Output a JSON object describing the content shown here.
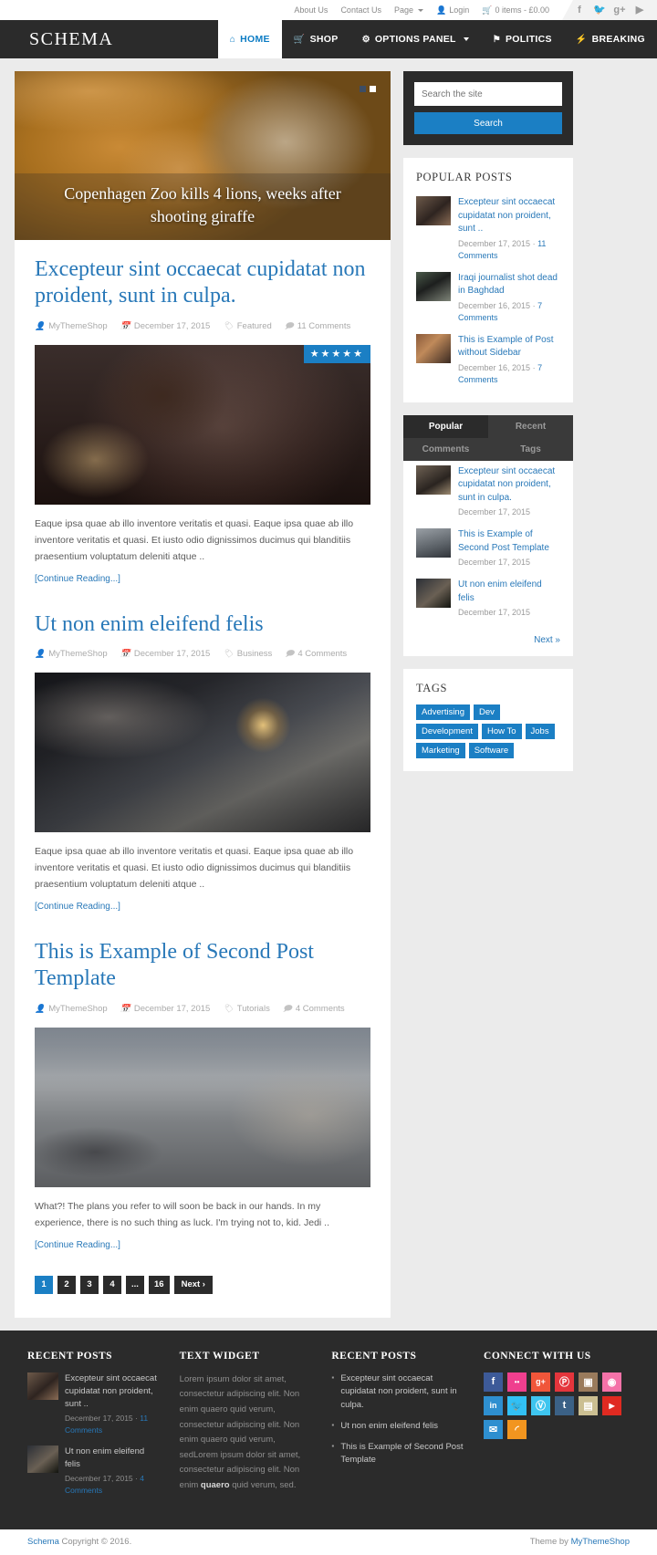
{
  "topbar": {
    "links": [
      {
        "label": "About Us",
        "caret": false
      },
      {
        "label": "Contact Us",
        "caret": false
      },
      {
        "label": "Page",
        "caret": true
      }
    ],
    "login": "Login",
    "cart": "0 items - £0.00",
    "social": [
      "f",
      "t",
      "g+",
      "yt"
    ]
  },
  "header": {
    "logo": "SCHEMA",
    "nav": [
      {
        "label": "HOME",
        "icon": "home-icon",
        "glyph": "⌂",
        "active": true,
        "caret": false
      },
      {
        "label": "SHOP",
        "icon": "cart-icon",
        "glyph": "Ὥ2",
        "active": false,
        "caret": false
      },
      {
        "label": "OPTIONS PANEL",
        "icon": "gears-icon",
        "glyph": "⚙",
        "active": false,
        "caret": true
      },
      {
        "label": "POLITICS",
        "icon": "flag-icon",
        "glyph": "⚑",
        "active": false,
        "caret": false
      },
      {
        "label": "BREAKING",
        "icon": "bolt-icon",
        "glyph": "⚡",
        "active": false,
        "caret": false
      }
    ]
  },
  "slider": {
    "caption": "Copenhagen Zoo kills 4 lions, weeks after shooting giraffe",
    "dots": [
      false,
      true
    ]
  },
  "posts": [
    {
      "title": "Excepteur sint occaecat cupidatat non proident, sunt in culpa.",
      "author": "MyThemeShop",
      "date": "December 17, 2015",
      "category": "Featured",
      "comments": "11 Comments",
      "rating": "★★★★★",
      "excerpt": "Eaque ipsa quae ab illo inventore veritatis et quasi. Eaque ipsa quae ab illo inventore veritatis et quasi. Et iusto odio dignissimos ducimus qui blanditiis praesentium voluptatum deleniti atque ..",
      "more": "[Continue Reading...]"
    },
    {
      "title": "Ut non enim eleifend felis",
      "author": "MyThemeShop",
      "date": "December 17, 2015",
      "category": "Business",
      "comments": "4 Comments",
      "rating": "",
      "excerpt": "Eaque ipsa quae ab illo inventore veritatis et quasi. Eaque ipsa quae ab illo inventore veritatis et quasi. Et iusto odio dignissimos ducimus qui blanditiis praesentium voluptatum deleniti atque ..",
      "more": "[Continue Reading...]"
    },
    {
      "title": "This is Example of Second Post Template",
      "author": "MyThemeShop",
      "date": "December 17, 2015",
      "category": "Tutorials",
      "comments": "4 Comments",
      "rating": "",
      "excerpt": "What?! The plans you refer to will soon be back in our hands. In my experience, there is no such thing as luck. I'm trying not to, kid. Jedi ..",
      "more": "[Continue Reading...]"
    }
  ],
  "pagination": {
    "pages": [
      "1",
      "2",
      "3",
      "4",
      "...",
      "16"
    ],
    "current": "1",
    "next": "Next ›"
  },
  "sidebar": {
    "search": {
      "placeholder": "Search the site",
      "button": "Search"
    },
    "popular_posts": {
      "title": "POPULAR POSTS",
      "items": [
        {
          "title": "Excepteur sint occaecat cupidatat non proident, sunt ..",
          "date": "December 17, 2015",
          "sep": "·",
          "comments": "11 Comments"
        },
        {
          "title": "Iraqi journalist shot dead in Baghdad",
          "date": "December 16, 2015",
          "sep": "·",
          "comments": "7 Comments"
        },
        {
          "title": "This is Example of Post without Sidebar",
          "date": "December 16, 2015",
          "sep": "·",
          "comments": "7 Comments"
        }
      ]
    },
    "tabs_widget": {
      "tabs": [
        {
          "label": "Popular",
          "active": true
        },
        {
          "label": "Recent",
          "active": false
        },
        {
          "label": "Comments",
          "active": false
        },
        {
          "label": "Tags",
          "active": false
        }
      ],
      "items": [
        {
          "title": "Excepteur sint occaecat cupidatat non proident, sunt in culpa.",
          "date": "December 17, 2015"
        },
        {
          "title": "This is Example of Second Post Template",
          "date": "December 17, 2015"
        },
        {
          "title": "Ut non enim eleifend felis",
          "date": "December 17, 2015"
        }
      ],
      "next": "Next »"
    },
    "tags": {
      "title": "TAGS",
      "items": [
        "Advertising",
        "Dev",
        "Development",
        "How To",
        "Jobs",
        "Marketing",
        "Software"
      ]
    }
  },
  "footer": {
    "col1": {
      "title": "RECENT POSTS",
      "items": [
        {
          "title": "Excepteur sint occaecat cupidatat non proident, sunt ..",
          "date": "December 17, 2015",
          "sep": "·",
          "comments": "11 Comments"
        },
        {
          "title": "Ut non enim eleifend felis",
          "date": "December 17, 2015",
          "sep": "·",
          "comments": "4 Comments"
        }
      ]
    },
    "col2": {
      "title": "TEXT WIDGET",
      "text_a": "Lorem ipsum dolor sit amet, consectetur adipiscing elit. Non enim quaero quid verum, consectetur adipiscing elit. Non enim quaero quid verum, sedLorem ipsum dolor sit amet, consectetur adipiscing elit. Non enim ",
      "text_bold": "quaero",
      "text_b": " quid verum, sed."
    },
    "col3": {
      "title": "RECENT POSTS",
      "items": [
        "Excepteur sint occaecat cupidatat non proident, sunt in culpa.",
        "Ut non enim eleifend felis",
        "This is Example of Second Post Template"
      ]
    },
    "col4": {
      "title": "CONNECT WITH US",
      "socials": [
        {
          "name": "facebook-icon",
          "glyph": "f",
          "color": "#3d5a98"
        },
        {
          "name": "flickr-icon",
          "glyph": "••",
          "color": "#ef3f8e"
        },
        {
          "name": "googleplus-icon",
          "glyph": "g+",
          "color": "#f0563a"
        },
        {
          "name": "pinterest-icon",
          "glyph": "Ⓟ",
          "color": "#e4353c"
        },
        {
          "name": "instagram-icon",
          "glyph": "▣",
          "color": "#9a7b5c"
        },
        {
          "name": "dribbble-icon",
          "glyph": "◉",
          "color": "#f472a8"
        },
        {
          "name": "linkedin-icon",
          "glyph": "in",
          "color": "#2e8fd0"
        },
        {
          "name": "twitter-icon",
          "glyph": "ᵗ",
          "color": "#32c0f5"
        },
        {
          "name": "vimeo-icon",
          "glyph": "Ⓥ",
          "color": "#3ec5ef"
        },
        {
          "name": "tumblr-icon",
          "glyph": "t",
          "color": "#3b6186"
        },
        {
          "name": "picasa-icon",
          "glyph": "▤",
          "color": "#cbbf92"
        },
        {
          "name": "youtube-icon",
          "glyph": "▶",
          "color": "#e02a21"
        },
        {
          "name": "email-icon",
          "glyph": "✉",
          "color": "#2e8fd0"
        },
        {
          "name": "rss-icon",
          "glyph": "◜",
          "color": "#f2951f"
        }
      ]
    }
  },
  "bottombar": {
    "brand": "Schema",
    "copyright": "Copyright © 2016.",
    "theme_by": "Theme by ",
    "theme_link": "MyThemeShop"
  }
}
